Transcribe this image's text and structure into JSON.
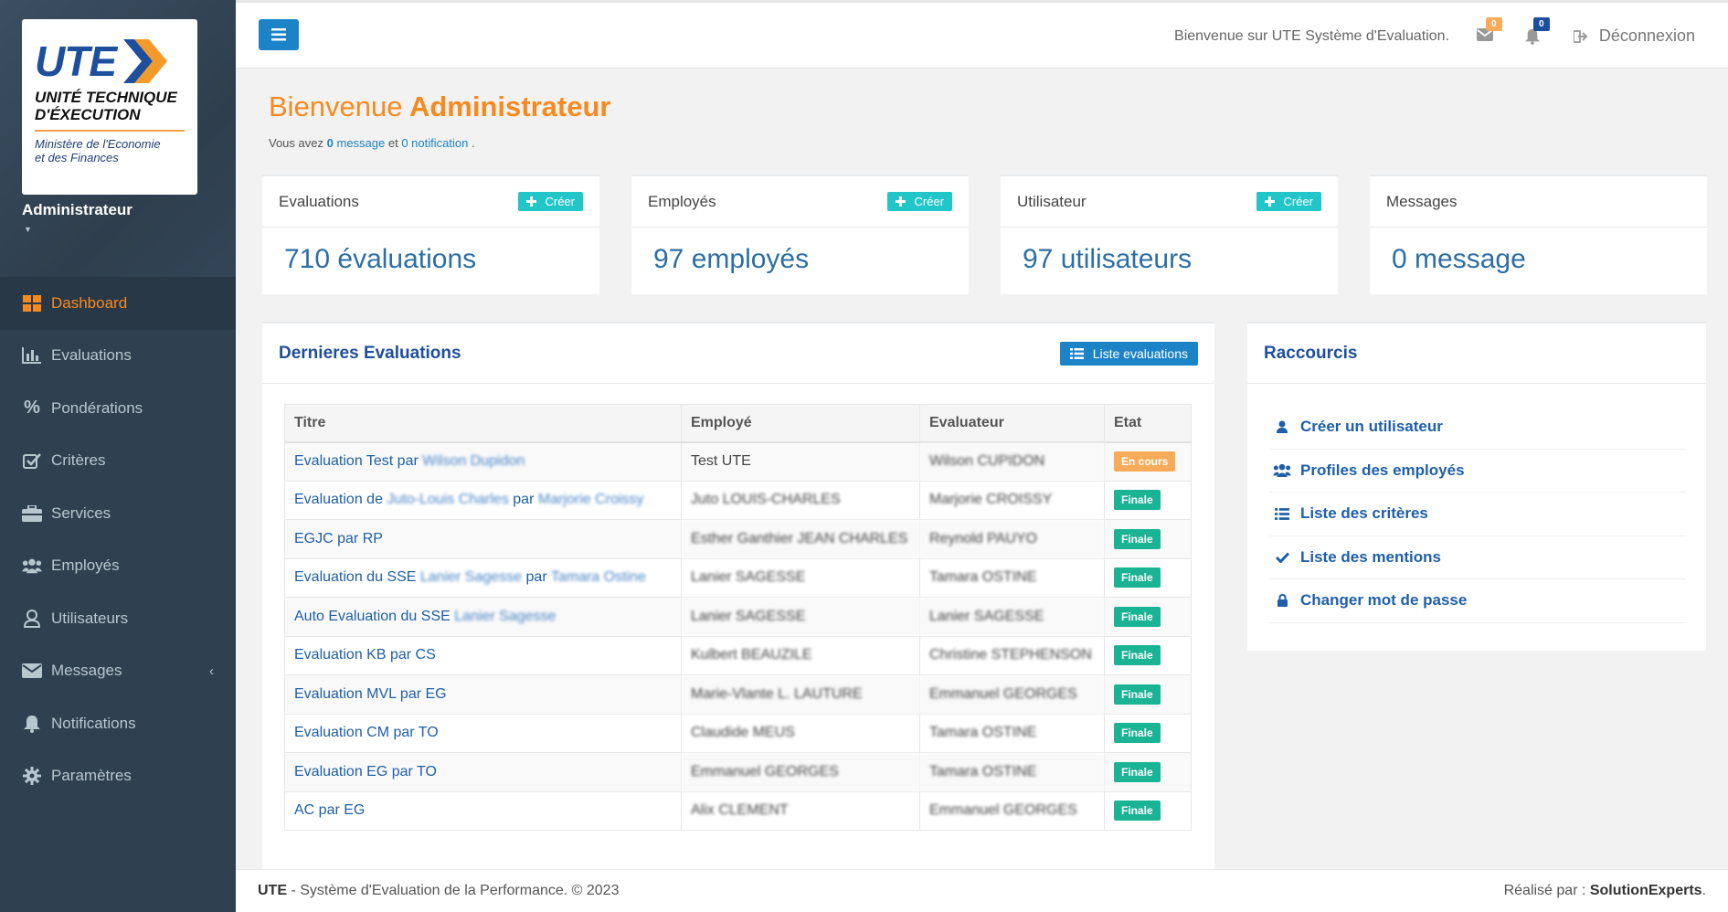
{
  "sidebar": {
    "logo": {
      "brand": "UTE",
      "line1a": "UNITÉ TECHNIQUE",
      "line1b": "D'ÉXECUTION",
      "line2a": "Ministère de l'Economie",
      "line2b": "et des Finances"
    },
    "profile_name": "Administrateur",
    "items": [
      {
        "label": "Dashboard",
        "icon": "dashboard-icon",
        "active": true
      },
      {
        "label": "Evaluations",
        "icon": "bar-chart-icon"
      },
      {
        "label": "Pondérations",
        "icon": "percent-icon"
      },
      {
        "label": "Critères",
        "icon": "check-square-icon"
      },
      {
        "label": "Services",
        "icon": "briefcase-icon"
      },
      {
        "label": "Employés",
        "icon": "users-icon"
      },
      {
        "label": "Utilisateurs",
        "icon": "user-icon"
      },
      {
        "label": "Messages",
        "icon": "envelope-icon",
        "has_submenu": true
      },
      {
        "label": "Notifications",
        "icon": "bell-icon"
      },
      {
        "label": "Paramètres",
        "icon": "gear-icon"
      }
    ]
  },
  "topbar": {
    "welcome": "Bienvenue sur UTE Système d'Evaluation.",
    "messages_count": "0",
    "notifications_count": "0",
    "logout_label": "Déconnexion"
  },
  "header": {
    "title_prefix": "Bienvenue",
    "title_name": "Administrateur",
    "sub_prefix": "Vous avez",
    "sub_msg_count": "0",
    "sub_msg_label": "message",
    "sub_and": "et",
    "sub_notif": "0 notification",
    "sub_end": "."
  },
  "stats": [
    {
      "title": "Evaluations",
      "value": "710 évaluations",
      "create_label": "Créer"
    },
    {
      "title": "Employés",
      "value": "97 employés",
      "create_label": "Créer"
    },
    {
      "title": "Utilisateur",
      "value": "97 utilisateurs",
      "create_label": "Créer"
    },
    {
      "title": "Messages",
      "value": "0 message"
    }
  ],
  "evaluations": {
    "title": "Dernieres Evaluations",
    "list_button": "Liste evaluations",
    "columns": [
      "Titre",
      "Employé",
      "Evaluateur",
      "Etat"
    ],
    "rows": [
      {
        "title": "Evaluation Test par",
        "title_blur": "Wilson Dupidon",
        "employee": "Test UTE",
        "employee_blurred": false,
        "evaluator": "Wilson CUPIDON",
        "state": "En cours",
        "state_kind": "enc"
      },
      {
        "title": "Evaluation de",
        "title_blur": "Juto-Louis Charles",
        "title_mid": "par",
        "title_blur2": "Marjorie Croissy",
        "employee": "Juto LOUIS-CHARLES",
        "employee_blurred": true,
        "evaluator": "Marjorie CROISSY",
        "state": "Finale",
        "state_kind": "fin"
      },
      {
        "title": "EGJC par RP",
        "employee": "Esther Ganthier JEAN CHARLES",
        "employee_blurred": true,
        "evaluator": "Reynold PAUYO",
        "state": "Finale",
        "state_kind": "fin"
      },
      {
        "title": "Evaluation du SSE",
        "title_blur": "Lanier Sagesse",
        "title_mid": "par",
        "title_blur2": "Tamara Ostine",
        "employee": "Lanier SAGESSE",
        "employee_blurred": true,
        "evaluator": "Tamara OSTINE",
        "state": "Finale",
        "state_kind": "fin"
      },
      {
        "title": "Auto Evaluation du SSE",
        "title_blur": "Lanier Sagesse",
        "employee": "Lanier SAGESSE",
        "employee_blurred": true,
        "evaluator": "Lanier SAGESSE",
        "state": "Finale",
        "state_kind": "fin"
      },
      {
        "title": "Evaluation KB par CS",
        "employee": "Kulbert BEAUZILE",
        "employee_blurred": true,
        "evaluator": "Christine STEPHENSON",
        "state": "Finale",
        "state_kind": "fin"
      },
      {
        "title": "Evaluation MVL par EG",
        "employee": "Marie-Vlante L. LAUTURE",
        "employee_blurred": true,
        "evaluator": "Emmanuel GEORGES",
        "state": "Finale",
        "state_kind": "fin"
      },
      {
        "title": "Evaluation CM par TO",
        "employee": "Claudide MEUS",
        "employee_blurred": true,
        "evaluator": "Tamara OSTINE",
        "state": "Finale",
        "state_kind": "fin"
      },
      {
        "title": "Evaluation EG par TO",
        "employee": "Emmanuel GEORGES",
        "employee_blurred": true,
        "evaluator": "Tamara OSTINE",
        "state": "Finale",
        "state_kind": "fin"
      },
      {
        "title": "AC par EG",
        "employee": "Alix CLEMENT",
        "employee_blurred": true,
        "evaluator": "Emmanuel GEORGES",
        "state": "Finale",
        "state_kind": "fin"
      }
    ]
  },
  "shortcuts": {
    "title": "Raccourcis",
    "items": [
      {
        "label": "Créer un utilisateur",
        "icon": "user-icon"
      },
      {
        "label": "Profiles des employés",
        "icon": "users-icon"
      },
      {
        "label": "Liste des critères",
        "icon": "list-icon"
      },
      {
        "label": "Liste des mentions",
        "icon": "check-icon"
      },
      {
        "label": "Changer mot de passe",
        "icon": "lock-icon"
      }
    ]
  },
  "footer": {
    "brand": "UTE",
    "text": " - Système d'Evaluation de la Performance. © 2023",
    "credit_prefix": "Réalisé par : ",
    "credit_name": "SolutionExperts",
    "credit_end": "."
  },
  "colors": {
    "sidebar_bg": "#2f4050",
    "accent_orange": "#f68a1f",
    "primary_blue": "#1c84c6",
    "create_teal": "#23c6c8",
    "finale_green": "#1ab394",
    "en_cours_orange": "#f8ac59"
  }
}
